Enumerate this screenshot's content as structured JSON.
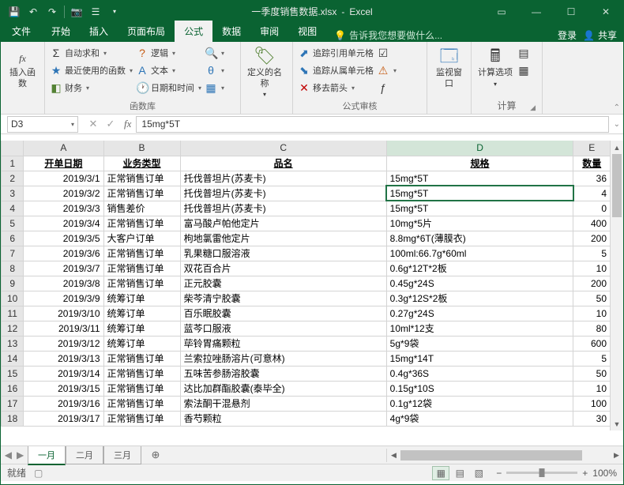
{
  "title": {
    "doc": "一季度销售数据.xlsx",
    "app": "Excel"
  },
  "qat": [
    "save",
    "undo",
    "redo",
    "camera",
    "quick-print",
    "dropdown"
  ],
  "tabs": {
    "file": "文件",
    "items": [
      "开始",
      "插入",
      "页面布局",
      "公式",
      "数据",
      "审阅",
      "视图"
    ],
    "active": "公式",
    "tellme": "告诉我您想要做什么...",
    "login": "登录",
    "share": "共享"
  },
  "ribbon": {
    "insertFn": "插入函数",
    "lib": {
      "autosum": "自动求和",
      "recent": "最近使用的函数",
      "financial": "财务",
      "logical": "逻辑",
      "text": "文本",
      "datetime": "日期和时间",
      "lookup": "",
      "math": "",
      "more": "",
      "label": "函数库"
    },
    "defnames": "定义的名称",
    "audit": {
      "tracePrec": "追踪引用单元格",
      "traceDep": "追踪从属单元格",
      "removeArrows": "移去箭头",
      "label": "公式审核"
    },
    "watch": "监视窗口",
    "calcopts": "计算选项",
    "calc": {
      "label": "计算"
    }
  },
  "namebox": "D3",
  "formulabar": "15mg*5T",
  "cols": [
    "A",
    "B",
    "C",
    "D",
    "E"
  ],
  "headers": {
    "A": "开单日期",
    "B": "业务类型",
    "C": "品名",
    "D": "规格",
    "E": "数量"
  },
  "rows": [
    {
      "n": 2,
      "A": "2019/3/1",
      "B": "正常销售订单",
      "C": "托伐普坦片(苏麦卡)",
      "D": "15mg*5T",
      "E": "36"
    },
    {
      "n": 3,
      "A": "2019/3/2",
      "B": "正常销售订单",
      "C": "托伐普坦片(苏麦卡)",
      "D": "15mg*5T",
      "E": "4"
    },
    {
      "n": 4,
      "A": "2019/3/3",
      "B": "销售差价",
      "C": "托伐普坦片(苏麦卡)",
      "D": "15mg*5T",
      "E": "0"
    },
    {
      "n": 5,
      "A": "2019/3/4",
      "B": "正常销售订单",
      "C": "富马酸卢帕他定片",
      "D": "10mg*5片",
      "E": "400"
    },
    {
      "n": 6,
      "A": "2019/3/5",
      "B": "大客户订单",
      "C": "枸地氯雷他定片",
      "D": "8.8mg*6T(薄膜衣)",
      "E": "200"
    },
    {
      "n": 7,
      "A": "2019/3/6",
      "B": "正常销售订单",
      "C": "乳果糖口服溶液",
      "D": "100ml:66.7g*60ml",
      "E": "5"
    },
    {
      "n": 8,
      "A": "2019/3/7",
      "B": "正常销售订单",
      "C": "双花百合片",
      "D": "0.6g*12T*2板",
      "E": "10"
    },
    {
      "n": 9,
      "A": "2019/3/8",
      "B": "正常销售订单",
      "C": "正元胶囊",
      "D": "0.45g*24S",
      "E": "200"
    },
    {
      "n": 10,
      "A": "2019/3/9",
      "B": "统筹订单",
      "C": "柴芩清宁胶囊",
      "D": "0.3g*12S*2板",
      "E": "50"
    },
    {
      "n": 11,
      "A": "2019/3/10",
      "B": "统筹订单",
      "C": "百乐眠胶囊",
      "D": "0.27g*24S",
      "E": "10"
    },
    {
      "n": 12,
      "A": "2019/3/11",
      "B": "统筹订单",
      "C": "蓝芩口服液",
      "D": "10ml*12支",
      "E": "80"
    },
    {
      "n": 13,
      "A": "2019/3/12",
      "B": "统筹订单",
      "C": "荜铃胃痛颗粒",
      "D": "5g*9袋",
      "E": "600"
    },
    {
      "n": 14,
      "A": "2019/3/13",
      "B": "正常销售订单",
      "C": "兰索拉唑肠溶片(可意林)",
      "D": "15mg*14T",
      "E": "5"
    },
    {
      "n": 15,
      "A": "2019/3/14",
      "B": "正常销售订单",
      "C": "五味苦参肠溶胶囊",
      "D": "0.4g*36S",
      "E": "50"
    },
    {
      "n": 16,
      "A": "2019/3/15",
      "B": "正常销售订单",
      "C": "达比加群酯胶囊(泰毕全)",
      "D": "0.15g*10S",
      "E": "10"
    },
    {
      "n": 17,
      "A": "2019/3/16",
      "B": "正常销售订单",
      "C": "索法酮干混悬剂",
      "D": "0.1g*12袋",
      "E": "100"
    },
    {
      "n": 18,
      "A": "2019/3/17",
      "B": "正常销售订单",
      "C": "香芍颗粒",
      "D": "4g*9袋",
      "E": "30"
    }
  ],
  "selectedCell": {
    "row": 3,
    "col": "D"
  },
  "sheetTabs": {
    "active": "一月",
    "others": [
      "二月",
      "三月"
    ]
  },
  "status": {
    "ready": "就绪",
    "zoom": "100%"
  }
}
